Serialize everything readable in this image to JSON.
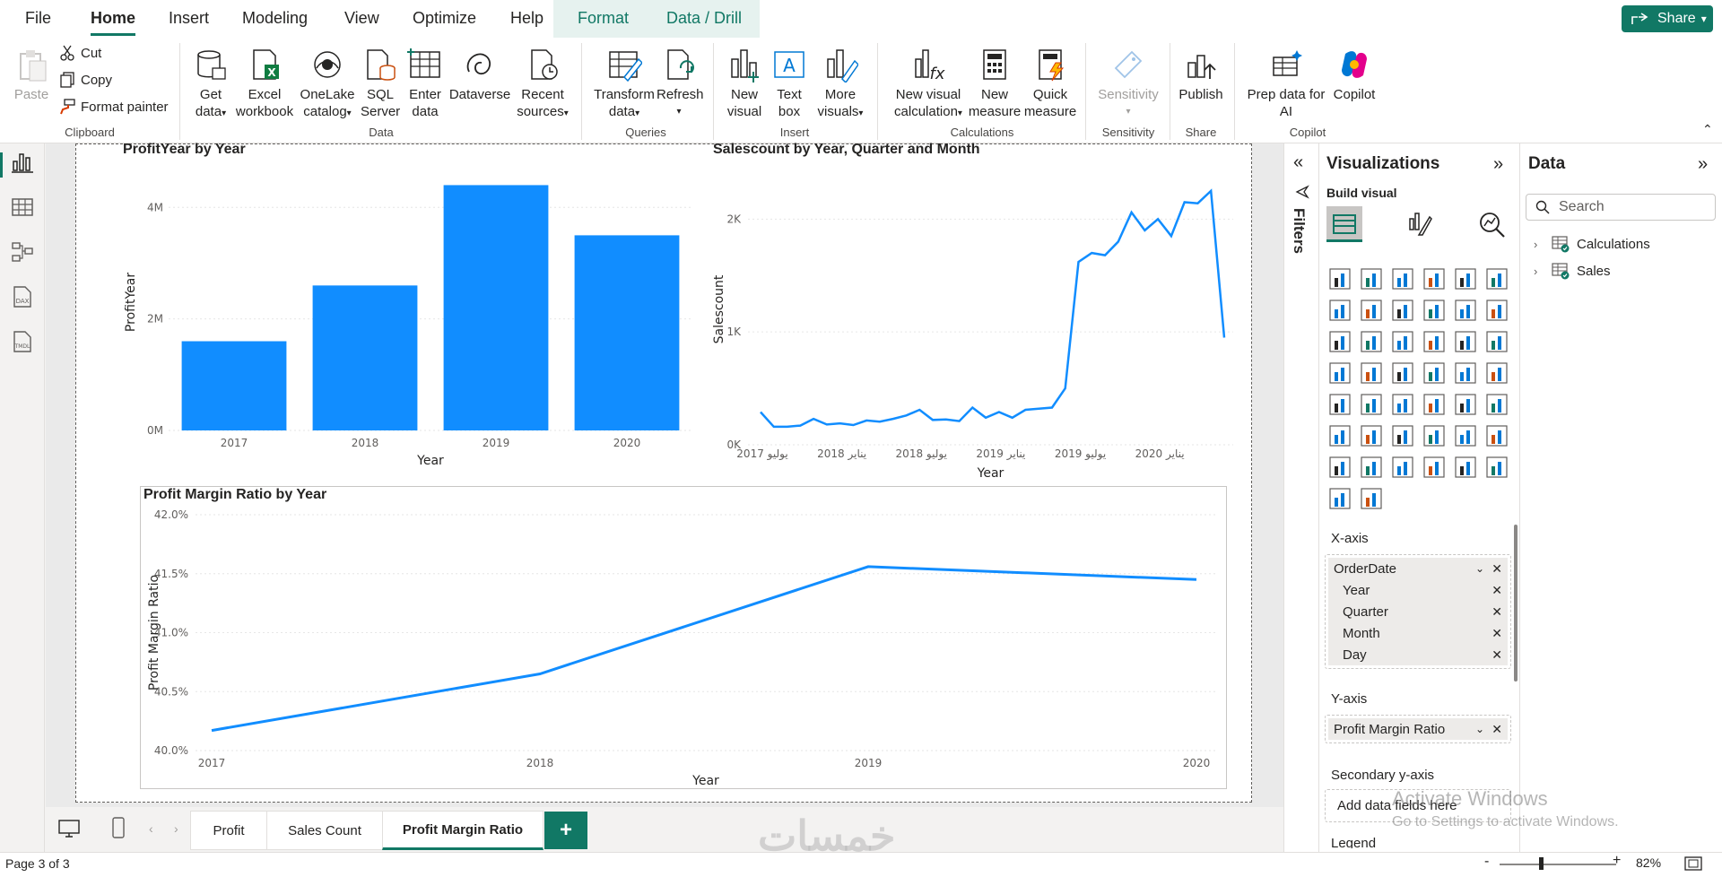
{
  "menu": {
    "items": [
      "File",
      "Home",
      "Insert",
      "Modeling",
      "View",
      "Optimize",
      "Help",
      "Format",
      "Data / Drill"
    ],
    "active": "Home",
    "share_label": "Share"
  },
  "ribbon": {
    "clipboard": {
      "paste": "Paste",
      "cut": "Cut",
      "copy": "Copy",
      "format_painter": "Format painter",
      "group": "Clipboard"
    },
    "data": {
      "get_data": [
        "Get",
        "data"
      ],
      "excel": [
        "Excel",
        "workbook"
      ],
      "onelake": [
        "OneLake",
        "catalog"
      ],
      "sql": [
        "SQL",
        "Server"
      ],
      "enter": [
        "Enter",
        "data"
      ],
      "dataverse": "Dataverse",
      "recent": [
        "Recent",
        "sources"
      ],
      "group": "Data"
    },
    "queries": {
      "transform": [
        "Transform",
        "data"
      ],
      "refresh": "Refresh",
      "group": "Queries"
    },
    "insert": {
      "new_visual": [
        "New",
        "visual"
      ],
      "text_box": [
        "Text",
        "box"
      ],
      "more_visuals": [
        "More",
        "visuals"
      ],
      "group": "Insert"
    },
    "calculations": {
      "new_visual_calc": [
        "New visual",
        "calculation"
      ],
      "new_measure": [
        "New",
        "measure"
      ],
      "quick_measure": [
        "Quick",
        "measure"
      ],
      "group": "Calculations"
    },
    "sensitivity": {
      "label": "Sensitivity",
      "group": "Sensitivity"
    },
    "share": {
      "publish": "Publish",
      "group": "Share"
    },
    "copilot": {
      "prep": [
        "Prep data for",
        "AI"
      ],
      "copilot": "Copilot",
      "group": "Copilot"
    }
  },
  "visuals": {
    "profit": {
      "title": "ProfitYear by Year",
      "xlabel": "Year",
      "ylabel": "ProfitYear"
    },
    "salescount": {
      "title": "Salescount by Year, Quarter and Month",
      "xlabel": "Year",
      "ylabel": "Salescount"
    },
    "margin": {
      "title": "Profit Margin Ratio by Year",
      "xlabel": "Year",
      "ylabel": "Profit Margin Ratio"
    }
  },
  "chart_data": [
    {
      "type": "bar",
      "title": "ProfitYear by Year",
      "xlabel": "Year",
      "ylabel": "ProfitYear",
      "categories": [
        "2017",
        "2018",
        "2019",
        "2020"
      ],
      "values": [
        1.6,
        2.6,
        4.4,
        3.5
      ],
      "ylim": [
        0,
        4.6
      ],
      "yticks": [
        {
          "v": 0,
          "label": "0M"
        },
        {
          "v": 2,
          "label": "2M"
        },
        {
          "v": 4,
          "label": "4M"
        }
      ],
      "color": "#118dff",
      "grid": true
    },
    {
      "type": "line",
      "title": "Salescount by Year, Quarter and Month",
      "xlabel": "Year",
      "ylabel": "Salescount",
      "xticks": [
        "يوليو 2017",
        "يناير 2018",
        "يوليو 2018",
        "يناير 2019",
        "يوليو 2019",
        "يناير 2020"
      ],
      "values": [
        290,
        160,
        160,
        170,
        230,
        180,
        190,
        175,
        215,
        205,
        230,
        260,
        310,
        220,
        225,
        210,
        330,
        240,
        290,
        240,
        310,
        320,
        330,
        500,
        1620,
        1700,
        1680,
        1800,
        2060,
        1900,
        2000,
        1850,
        2150,
        2140,
        2250,
        950
      ],
      "ylim": [
        0,
        2400
      ],
      "yticks": [
        {
          "v": 0,
          "label": "0K"
        },
        {
          "v": 1000,
          "label": "1K"
        },
        {
          "v": 2000,
          "label": "2K"
        }
      ],
      "color": "#118dff",
      "grid": true
    },
    {
      "type": "line",
      "title": "Profit Margin Ratio by Year",
      "xlabel": "Year",
      "ylabel": "Profit Margin Ratio",
      "categories": [
        "2017",
        "2018",
        "2019",
        "2020"
      ],
      "values": [
        40.17,
        40.65,
        41.56,
        41.45
      ],
      "ylim": [
        40.0,
        42.0
      ],
      "yticks": [
        {
          "v": 40.0,
          "label": "40.0%"
        },
        {
          "v": 40.5,
          "label": "40.5%"
        },
        {
          "v": 41.0,
          "label": "41.0%"
        },
        {
          "v": 41.5,
          "label": "41.5%"
        },
        {
          "v": 42.0,
          "label": "42.0%"
        }
      ],
      "color": "#118dff",
      "grid": true
    }
  ],
  "filters": {
    "label": "Filters"
  },
  "viz_pane": {
    "title": "Visualizations",
    "build_visual": "Build visual",
    "xaxis_label": "X-axis",
    "xaxis_field": "OrderDate",
    "xaxis_subfields": [
      "Year",
      "Quarter",
      "Month",
      "Day"
    ],
    "yaxis_label": "Y-axis",
    "yaxis_field": "Profit Margin Ratio",
    "secondary_label": "Secondary y-axis",
    "add_fields": "Add data fields here",
    "legend_label": "Legend"
  },
  "data_pane": {
    "title": "Data",
    "search_placeholder": "Search",
    "tables": [
      "Calculations",
      "Sales"
    ]
  },
  "pages": {
    "tabs": [
      "Profit",
      "Sales Count",
      "Profit Margin Ratio"
    ],
    "active": "Profit Margin Ratio",
    "indicator": "Page 3 of 3"
  },
  "status": {
    "zoom": "82%"
  },
  "watermark": {
    "line1": "Activate Windows",
    "line2": "Go to Settings to activate Windows.",
    "logo": "خمسات"
  }
}
